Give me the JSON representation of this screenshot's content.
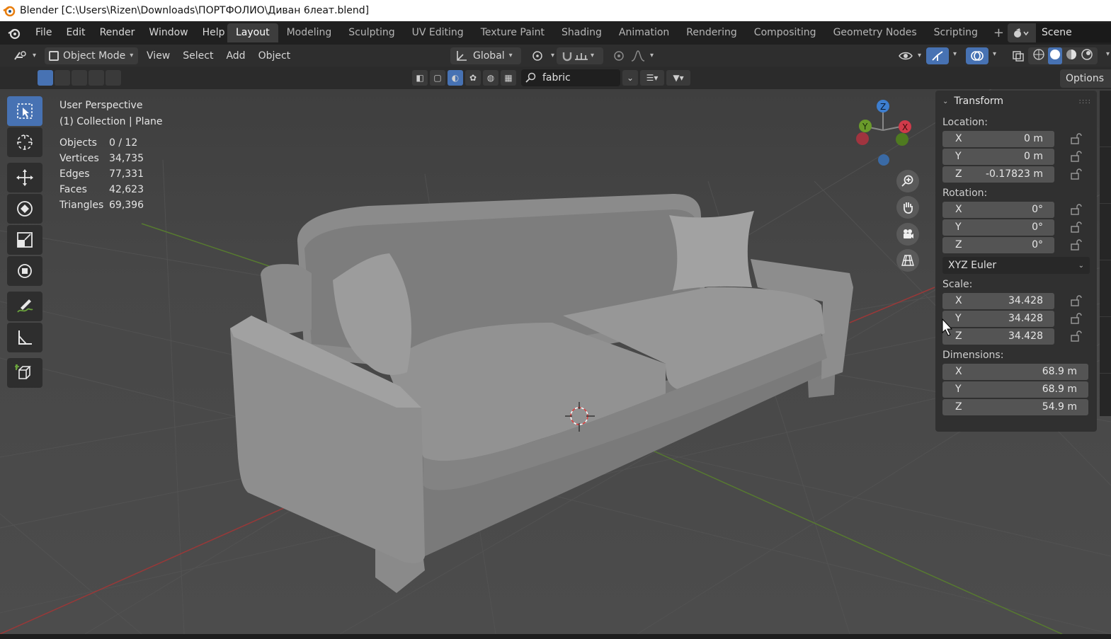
{
  "window": {
    "title": "Blender [C:\\Users\\Rizen\\Downloads\\ПОРТФОЛИО\\Диван 6леат.blend]"
  },
  "menu": {
    "items": [
      "File",
      "Edit",
      "Render",
      "Window",
      "Help"
    ]
  },
  "workspaces": {
    "tabs": [
      "Layout",
      "Modeling",
      "Sculpting",
      "UV Editing",
      "Texture Paint",
      "Shading",
      "Animation",
      "Rendering",
      "Compositing",
      "Geometry Nodes",
      "Scripting"
    ],
    "active": "Layout",
    "add": "+"
  },
  "scene": {
    "name": "Scene"
  },
  "header": {
    "mode": "Object Mode",
    "menus": [
      "View",
      "Select",
      "Add",
      "Object"
    ],
    "orientation": "Global"
  },
  "filter": {
    "search_value": "fabric"
  },
  "options_label": "Options",
  "viewport": {
    "perspective": "User Perspective",
    "collection": "(1) Collection | Plane",
    "stats": [
      {
        "k": "Objects",
        "v": "0 / 12"
      },
      {
        "k": "Vertices",
        "v": "34,735"
      },
      {
        "k": "Edges",
        "v": "77,331"
      },
      {
        "k": "Faces",
        "v": "42,623"
      },
      {
        "k": "Triangles",
        "v": "69,396"
      }
    ]
  },
  "gizmo": {
    "x": "X",
    "y": "Y",
    "z": "Z"
  },
  "transform": {
    "title": "Transform",
    "location_label": "Location:",
    "location": [
      {
        "axis": "X",
        "value": "0 m"
      },
      {
        "axis": "Y",
        "value": "0 m"
      },
      {
        "axis": "Z",
        "value": "-0.17823 m"
      }
    ],
    "rotation_label": "Rotation:",
    "rotation": [
      {
        "axis": "X",
        "value": "0°"
      },
      {
        "axis": "Y",
        "value": "0°"
      },
      {
        "axis": "Z",
        "value": "0°"
      }
    ],
    "rotation_mode": "XYZ Euler",
    "scale_label": "Scale:",
    "scale": [
      {
        "axis": "X",
        "value": "34.428"
      },
      {
        "axis": "Y",
        "value": "34.428"
      },
      {
        "axis": "Z",
        "value": "34.428"
      }
    ],
    "dimensions_label": "Dimensions:",
    "dimensions": [
      {
        "axis": "X",
        "value": "68.9 m"
      },
      {
        "axis": "Y",
        "value": "68.9 m"
      },
      {
        "axis": "Z",
        "value": "54.9 m"
      }
    ]
  },
  "colors": {
    "accent": "#4772b3",
    "axis_x": "#d03a4a",
    "axis_y": "#6a9a2a",
    "axis_z": "#3d7ecf"
  }
}
